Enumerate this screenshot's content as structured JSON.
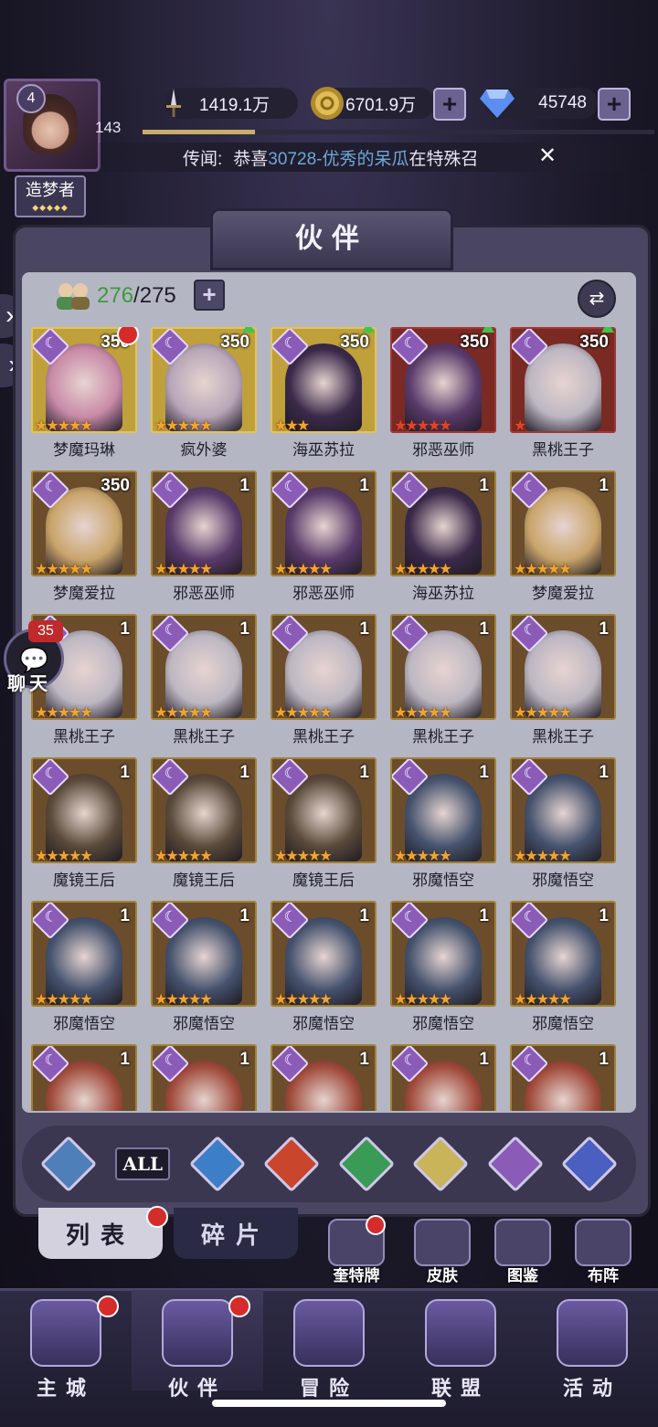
{
  "player": {
    "level": "4",
    "id_number": "143",
    "title": "造梦者",
    "xp_fraction": 0.22
  },
  "resources": [
    {
      "icon": "sword-icon",
      "value": "1419.1万"
    },
    {
      "icon": "gold-coin-icon",
      "value": "6701.9万"
    },
    {
      "icon": "diamond-icon",
      "value": "45748"
    }
  ],
  "rumor": {
    "label": "传闻:",
    "prefix": "恭喜",
    "highlight": "30728-优秀的呆瓜",
    "suffix": "在特殊召"
  },
  "panel": {
    "title": "伙伴",
    "count_current": "276",
    "count_max": "/275"
  },
  "heroes": [
    {
      "name": "梦魔玛琳",
      "level": "350",
      "stars": 5,
      "frame": "gold",
      "badge": "dot"
    },
    {
      "name": "疯外婆",
      "level": "350",
      "stars": 5,
      "frame": "gold",
      "badge": "up"
    },
    {
      "name": "海巫苏拉",
      "level": "350",
      "stars": 3,
      "frame": "gold",
      "badge": "up"
    },
    {
      "name": "邪恶巫师",
      "level": "350",
      "stars": 5,
      "frame": "red",
      "badge": "up"
    },
    {
      "name": "黑桃王子",
      "level": "350",
      "stars": 1,
      "frame": "red",
      "badge": "up"
    },
    {
      "name": "梦魔爱拉",
      "level": "350",
      "stars": 5,
      "frame": "brown",
      "badge": ""
    },
    {
      "name": "邪恶巫师",
      "level": "1",
      "stars": 5,
      "frame": "brown",
      "badge": ""
    },
    {
      "name": "邪恶巫师",
      "level": "1",
      "stars": 5,
      "frame": "brown",
      "badge": ""
    },
    {
      "name": "海巫苏拉",
      "level": "1",
      "stars": 5,
      "frame": "brown",
      "badge": ""
    },
    {
      "name": "梦魔爱拉",
      "level": "1",
      "stars": 5,
      "frame": "brown",
      "badge": ""
    },
    {
      "name": "黑桃王子",
      "level": "1",
      "stars": 5,
      "frame": "brown",
      "badge": ""
    },
    {
      "name": "黑桃王子",
      "level": "1",
      "stars": 5,
      "frame": "brown",
      "badge": ""
    },
    {
      "name": "黑桃王子",
      "level": "1",
      "stars": 5,
      "frame": "brown",
      "badge": ""
    },
    {
      "name": "黑桃王子",
      "level": "1",
      "stars": 5,
      "frame": "brown",
      "badge": ""
    },
    {
      "name": "黑桃王子",
      "level": "1",
      "stars": 5,
      "frame": "brown",
      "badge": ""
    },
    {
      "name": "魔镜王后",
      "level": "1",
      "stars": 5,
      "frame": "brown",
      "badge": ""
    },
    {
      "name": "魔镜王后",
      "level": "1",
      "stars": 5,
      "frame": "brown",
      "badge": ""
    },
    {
      "name": "魔镜王后",
      "level": "1",
      "stars": 5,
      "frame": "brown",
      "badge": ""
    },
    {
      "name": "邪魔悟空",
      "level": "1",
      "stars": 5,
      "frame": "brown",
      "badge": ""
    },
    {
      "name": "邪魔悟空",
      "level": "1",
      "stars": 5,
      "frame": "brown",
      "badge": ""
    },
    {
      "name": "邪魔悟空",
      "level": "1",
      "stars": 5,
      "frame": "brown",
      "badge": ""
    },
    {
      "name": "邪魔悟空",
      "level": "1",
      "stars": 5,
      "frame": "brown",
      "badge": ""
    },
    {
      "name": "邪魔悟空",
      "level": "1",
      "stars": 5,
      "frame": "brown",
      "badge": ""
    },
    {
      "name": "邪魔悟空",
      "level": "1",
      "stars": 5,
      "frame": "brown",
      "badge": ""
    },
    {
      "name": "邪魔悟空",
      "level": "1",
      "stars": 5,
      "frame": "brown",
      "badge": ""
    },
    {
      "name": "",
      "level": "1",
      "stars": 0,
      "frame": "brown",
      "badge": ""
    },
    {
      "name": "",
      "level": "1",
      "stars": 0,
      "frame": "brown",
      "badge": ""
    },
    {
      "name": "",
      "level": "1",
      "stars": 0,
      "frame": "brown",
      "badge": ""
    },
    {
      "name": "",
      "level": "1",
      "stars": 0,
      "frame": "brown",
      "badge": ""
    },
    {
      "name": "",
      "level": "1",
      "stars": 0,
      "frame": "brown",
      "badge": ""
    }
  ],
  "filters": [
    {
      "name": "filter-ascend-icon",
      "color": "#4f7fb8",
      "label": ""
    },
    {
      "name": "filter-all",
      "color": "#1d1a2a",
      "label": "ALL"
    },
    {
      "name": "filter-water-icon",
      "color": "#3d7ec9",
      "label": ""
    },
    {
      "name": "filter-fire-icon",
      "color": "#c9452c",
      "label": ""
    },
    {
      "name": "filter-wind-icon",
      "color": "#3a9b56",
      "label": ""
    },
    {
      "name": "filter-light-icon",
      "color": "#c9b45a",
      "label": ""
    },
    {
      "name": "filter-moon-icon",
      "color": "#8b5bb8",
      "label": ""
    },
    {
      "name": "filter-cosmos-icon",
      "color": "#4a5fc0",
      "label": ""
    }
  ],
  "tabs": {
    "list": "列表",
    "fragments": "碎片"
  },
  "side_buttons": [
    {
      "label": "奎特牌",
      "dot": true
    },
    {
      "label": "皮肤",
      "dot": false
    },
    {
      "label": "图鉴",
      "dot": false
    },
    {
      "label": "布阵",
      "dot": false
    }
  ],
  "chat": {
    "badge": "35",
    "label": "聊天"
  },
  "nav": [
    {
      "label": "主城",
      "dot": true,
      "active": false
    },
    {
      "label": "伙伴",
      "dot": true,
      "active": true
    },
    {
      "label": "冒险",
      "dot": false,
      "active": false
    },
    {
      "label": "联盟",
      "dot": false,
      "active": false
    },
    {
      "label": "活动",
      "dot": false,
      "active": false
    }
  ],
  "colors": {
    "accent": "#8b5bb8",
    "highlight_text": "#6fa7d8",
    "count_green": "#3d9b3a",
    "red_dot": "#d62b2b"
  }
}
